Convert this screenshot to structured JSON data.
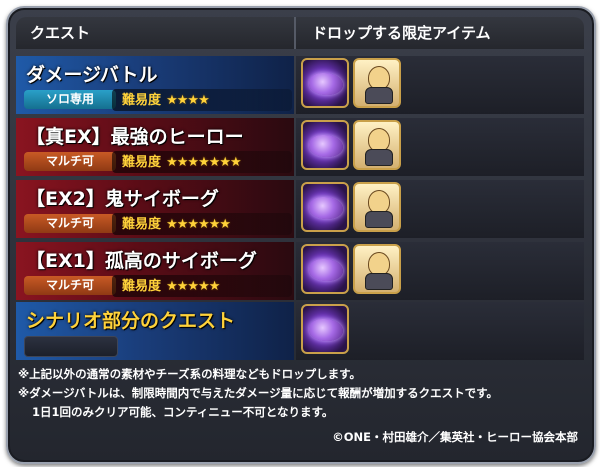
{
  "header": {
    "quest_col": "クエスト",
    "drop_col": "ドロップする限定アイテム"
  },
  "rows": [
    {
      "title": "ダメージバトル",
      "badge": "ソロ専用",
      "badge_type": "solo",
      "difficulty_label": "難易度",
      "stars": "★★★★",
      "star_count": 4,
      "drops": [
        "material-icon",
        "hero-icon"
      ]
    },
    {
      "title": "【真EX】最強のヒーロー",
      "badge": "マルチ可",
      "badge_type": "multi",
      "difficulty_label": "難易度",
      "stars": "★★★★★★★",
      "star_count": 7,
      "drops": [
        "material-icon",
        "hero-icon"
      ]
    },
    {
      "title": "【EX2】鬼サイボーグ",
      "badge": "マルチ可",
      "badge_type": "multi",
      "difficulty_label": "難易度",
      "stars": "★★★★★★",
      "star_count": 6,
      "drops": [
        "material-icon",
        "hero-icon"
      ]
    },
    {
      "title": "【EX1】孤高のサイボーグ",
      "badge": "マルチ可",
      "badge_type": "multi",
      "difficulty_label": "難易度",
      "stars": "★★★★★",
      "star_count": 5,
      "drops": [
        "material-icon",
        "hero-icon"
      ]
    },
    {
      "title": "シナリオ部分のクエスト",
      "badge": "",
      "badge_type": "blank",
      "drops": [
        "material-icon"
      ]
    }
  ],
  "notes": [
    "※上記以外の通常の素材やチーズ系の料理などもドロップします。",
    "※ダメージバトルは、制限時間内で与えたダメージ量に応じて報酬が増加するクエストです。",
    "1日1回のみクリア可能、コンティニュー不可となります。"
  ],
  "copyright": "©ONE・村田雄介／集英社・ヒーロー協会本部",
  "colors": {
    "gold": "#ffd23a",
    "solo_badge": "#2aa0c8",
    "multi_badge": "#c85a25",
    "frame": "#c9a04a"
  }
}
